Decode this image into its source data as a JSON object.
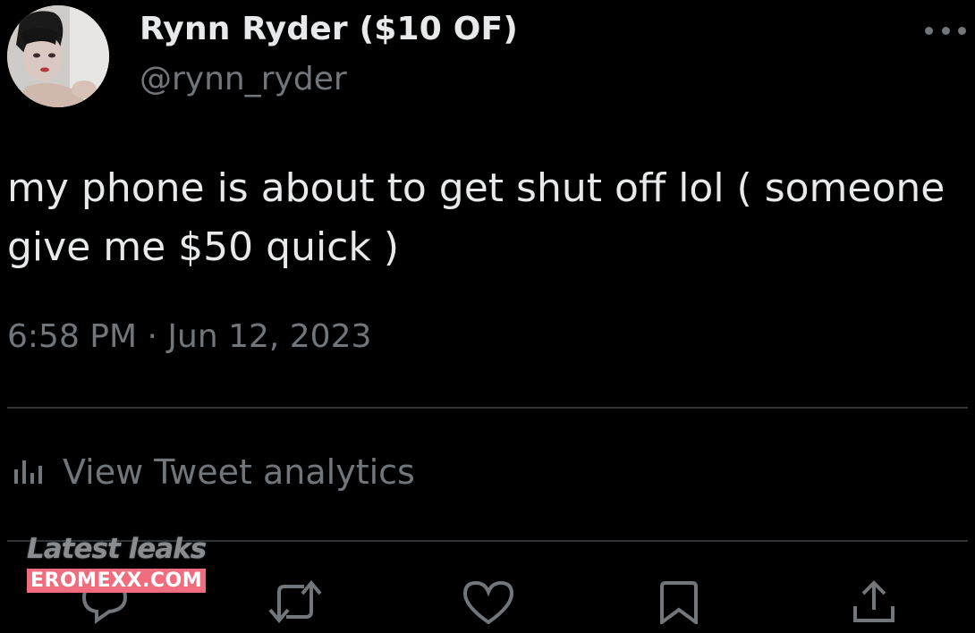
{
  "author": {
    "display_name": "Rynn Ryder ($10 OF)",
    "handle": "@rynn_ryder",
    "avatar_icon": "profile-photo"
  },
  "header": {
    "more_icon": "more-horizontal-icon"
  },
  "tweet": {
    "text": "my phone is about to get shut off lol ( someone give me $50 quick )",
    "timestamp": "6:58 PM · Jun 12, 2023"
  },
  "analytics": {
    "label": "View Tweet analytics",
    "icon": "bar-chart-icon"
  },
  "actions": {
    "icons": [
      "reply-icon",
      "retweet-icon",
      "like-icon",
      "bookmark-icon",
      "share-icon"
    ]
  },
  "watermark": {
    "line1": "Latest leaks",
    "line2": "EROMEXX.COM",
    "badge_color": "#f06d80"
  },
  "colors": {
    "background": "#000000",
    "primary_text": "#e7e9ea",
    "secondary_text": "#71767b",
    "divider": "#2f3336"
  }
}
